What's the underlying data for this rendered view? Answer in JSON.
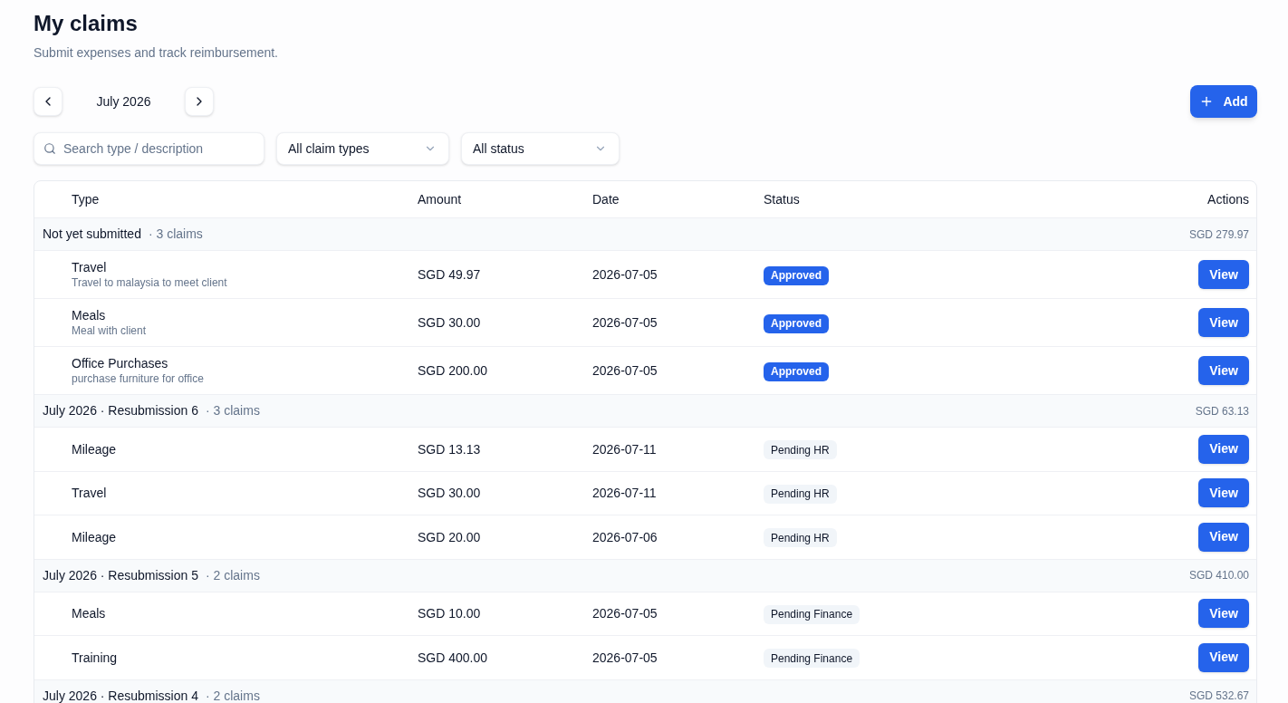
{
  "page": {
    "title": "My claims",
    "subtitle": "Submit expenses and track reimbursement."
  },
  "month_nav": {
    "label": "July 2026"
  },
  "add_button": {
    "label": "Add"
  },
  "filters": {
    "search": {
      "placeholder": "Search type / description"
    },
    "claim_type": {
      "value": "All claim types"
    },
    "status": {
      "value": "All status"
    }
  },
  "table": {
    "columns": [
      "Type",
      "Amount",
      "Date",
      "Status",
      "Actions"
    ],
    "groups": [
      {
        "title": "Not yet submitted",
        "count": "· 3 claims",
        "total": "SGD 279.97",
        "rows": [
          {
            "type": "Travel",
            "description": "Travel to malaysia to meet client",
            "amount": "SGD 49.97",
            "date": "2026-07-05",
            "status": {
              "label": "Approved",
              "kind": "approved"
            },
            "action": "View"
          },
          {
            "type": "Meals",
            "description": "Meal with client",
            "amount": "SGD 30.00",
            "date": "2026-07-05",
            "status": {
              "label": "Approved",
              "kind": "approved"
            },
            "action": "View"
          },
          {
            "type": "Office Purchases",
            "description": "purchase furniture for office",
            "amount": "SGD 200.00",
            "date": "2026-07-05",
            "status": {
              "label": "Approved",
              "kind": "approved"
            },
            "action": "View"
          }
        ]
      },
      {
        "title": "July 2026 · Resubmission 6",
        "count": "· 3 claims",
        "total": "SGD 63.13",
        "rows": [
          {
            "type": "Mileage",
            "amount": "SGD 13.13",
            "date": "2026-07-11",
            "status": {
              "label": "Pending HR",
              "kind": "pending"
            },
            "action": "View"
          },
          {
            "type": "Travel",
            "amount": "SGD 30.00",
            "date": "2026-07-11",
            "status": {
              "label": "Pending HR",
              "kind": "pending"
            },
            "action": "View"
          },
          {
            "type": "Mileage",
            "amount": "SGD 20.00",
            "date": "2026-07-06",
            "status": {
              "label": "Pending HR",
              "kind": "pending"
            },
            "action": "View"
          }
        ]
      },
      {
        "title": "July 2026 · Resubmission 5",
        "count": "· 2 claims",
        "total": "SGD 410.00",
        "rows": [
          {
            "type": "Meals",
            "amount": "SGD 10.00",
            "date": "2026-07-05",
            "status": {
              "label": "Pending Finance",
              "kind": "pending"
            },
            "action": "View"
          },
          {
            "type": "Training",
            "amount": "SGD 400.00",
            "date": "2026-07-05",
            "status": {
              "label": "Pending Finance",
              "kind": "pending"
            },
            "action": "View"
          }
        ]
      },
      {
        "title": "July 2026 · Resubmission 4",
        "count": "· 2 claims",
        "total": "SGD 532.67"
      }
    ]
  }
}
